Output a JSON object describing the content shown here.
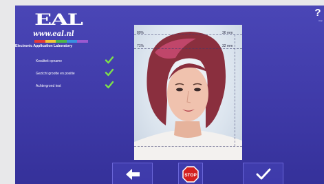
{
  "brand": {
    "logo_text": "EAL",
    "url": "www.eal.nl",
    "tagline": "Electronic Application Laboratory",
    "stripe_colors": [
      "#e23b3b",
      "#f2c43a",
      "#4fb84a",
      "#3a8fe0",
      "#9b59d0"
    ]
  },
  "checklist": {
    "items": [
      {
        "label": "Kwaliteit opname",
        "status": "ok"
      },
      {
        "label": "Gezicht grootte en positie",
        "status": "ok"
      },
      {
        "label": "Achtergrond test",
        "status": "ok"
      }
    ],
    "check_color": "#7ee04a"
  },
  "help": {
    "label": "?",
    "sub": "Help"
  },
  "photo": {
    "measurements": {
      "top_left": "80%",
      "mid_left": "71%",
      "top_right": "36 mm",
      "mid_right": "32 mm"
    }
  },
  "toolbar": {
    "back_icon": "arrow-left-icon",
    "stop_label": "STOP",
    "confirm_icon": "checkmark-icon",
    "stop_color": "#d32020"
  }
}
